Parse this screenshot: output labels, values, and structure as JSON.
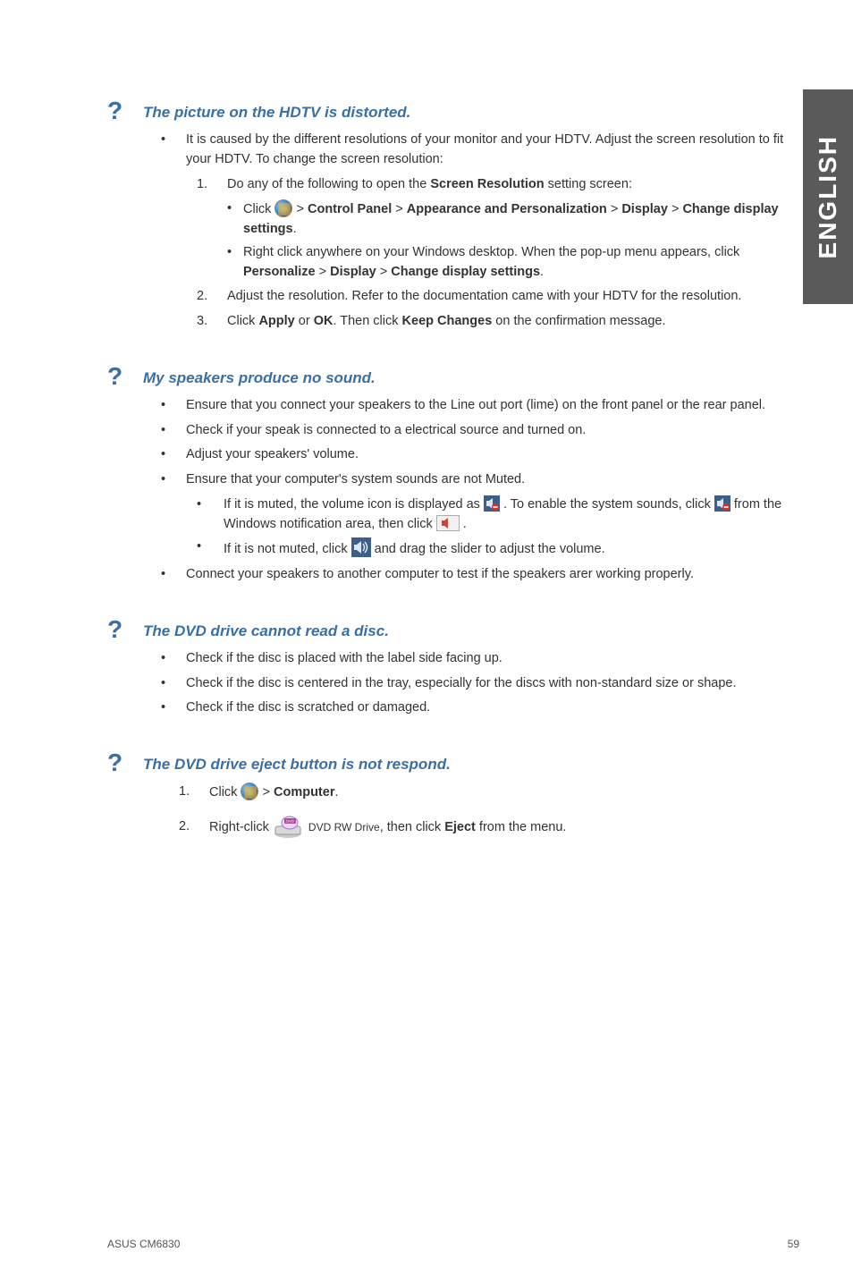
{
  "side_tab": "ENGLISH",
  "q1": {
    "title": "The picture on the HDTV is distorted.",
    "intro": "It is caused by the different resolutions of your monitor and your HDTV. Adjust the screen resolution to fit your HDTV. To change the screen resolution:",
    "step1_lead": "Do any of the following to open the ",
    "step1_bold": "Screen Resolution",
    "step1_tail": " setting screen:",
    "s1a_lead": "Click ",
    "s1a_p1": "Control Panel",
    "s1a_p2": "Appearance and Personalization",
    "s1a_p3": "Display",
    "s1a_p4": "Change display settings",
    "s1b_lead": "Right click anywhere on your Windows desktop. When the pop-up menu appears, click ",
    "s1b_p1": "Personalize",
    "s1b_p2": "Display",
    "s1b_p3": "Change display settings",
    "step2": "Adjust the resolution. Refer to the documentation came with your HDTV for the resolution.",
    "step3_lead": "Click ",
    "step3_b1": "Apply",
    "step3_mid": " or ",
    "step3_b2": "OK",
    "step3_mid2": ". Then click ",
    "step3_b3": "Keep Changes",
    "step3_tail": " on the confirmation message."
  },
  "q2": {
    "title": "My speakers produce no sound.",
    "b1": "Ensure that you connect your speakers to the Line out port (lime) on the front panel or the rear panel.",
    "b2": "Check if your speak is connected to a electrical source and turned on.",
    "b3": "Adjust your speakers' volume.",
    "b4": "Ensure that your computer's system sounds are not Muted.",
    "b4a_lead": "If it is muted, the volume icon is displayed as ",
    "b4a_mid": " . To enable the system sounds, click ",
    "b4a_mid2": " from the Windows notification area, then click ",
    "b4a_tail": " .",
    "b4b_lead": "If it is not muted, click ",
    "b4b_tail": " and drag the slider to adjust the volume.",
    "b5": "Connect your speakers to another computer to test if the speakers arer working properly."
  },
  "q3": {
    "title": "The DVD drive cannot read a disc.",
    "b1": "Check if the disc is placed with the label side facing up.",
    "b2": "Check if the disc is centered in the tray, especially for the discs with non-standard size or shape.",
    "b3": "Check if the disc is scratched or damaged."
  },
  "q4": {
    "title": "The DVD drive eject button is not respond.",
    "s1_lead": "Click ",
    "s1_bold": "Computer",
    "s2_lead": "Right-click ",
    "s2_drive_label": "DVD RW Drive",
    "s2_mid": ", then click ",
    "s2_bold": "Eject",
    "s2_tail": " from the menu."
  },
  "footer": {
    "left": "ASUS CM6830",
    "right": "59"
  }
}
